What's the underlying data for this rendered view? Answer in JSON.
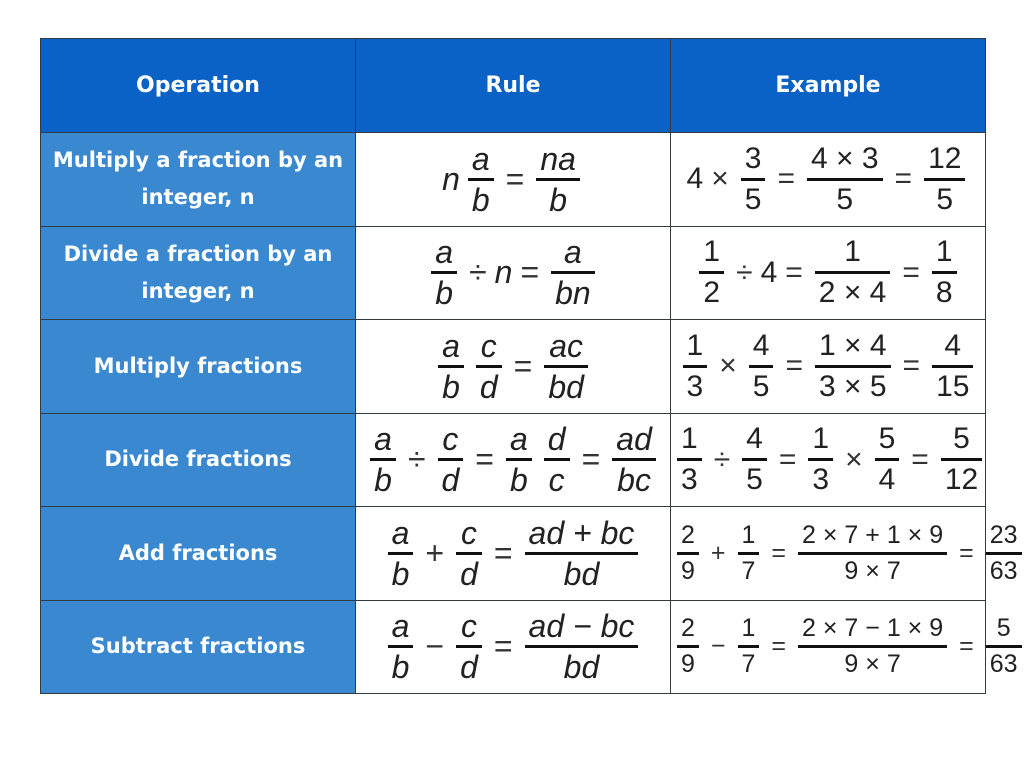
{
  "header": {
    "operation": "Operation",
    "rule": "Rule",
    "example": "Example"
  },
  "rows": [
    {
      "operation": "Multiply a fraction by an integer, n",
      "rule": [
        {
          "t": "term",
          "v": "n"
        },
        {
          "t": "frac",
          "n": "a",
          "d": "b"
        },
        {
          "t": "op",
          "v": "="
        },
        {
          "t": "frac",
          "n": "na",
          "d": "b"
        }
      ],
      "example": [
        {
          "t": "term",
          "v": "4"
        },
        {
          "t": "op",
          "v": "×"
        },
        {
          "t": "frac",
          "n": "3",
          "d": "5"
        },
        {
          "t": "op",
          "v": "="
        },
        {
          "t": "frac",
          "n": "4 × 3",
          "d": "5"
        },
        {
          "t": "op",
          "v": "="
        },
        {
          "t": "frac",
          "n": "12",
          "d": "5"
        }
      ]
    },
    {
      "operation": "Divide a fraction by an integer, n",
      "rule": [
        {
          "t": "frac",
          "n": "a",
          "d": "b"
        },
        {
          "t": "op",
          "v": "÷"
        },
        {
          "t": "term",
          "v": "n"
        },
        {
          "t": "op",
          "v": "="
        },
        {
          "t": "frac",
          "n": "a",
          "d": "bn"
        }
      ],
      "example": [
        {
          "t": "frac",
          "n": "1",
          "d": "2"
        },
        {
          "t": "op",
          "v": "÷"
        },
        {
          "t": "term",
          "v": "4"
        },
        {
          "t": "op",
          "v": "="
        },
        {
          "t": "frac",
          "n": "1",
          "d": "2 × 4"
        },
        {
          "t": "op",
          "v": "="
        },
        {
          "t": "frac",
          "n": "1",
          "d": "8"
        }
      ]
    },
    {
      "operation": "Multiply fractions",
      "rule": [
        {
          "t": "frac",
          "n": "a",
          "d": "b"
        },
        {
          "t": "frac",
          "n": "c",
          "d": "d"
        },
        {
          "t": "op",
          "v": "="
        },
        {
          "t": "frac",
          "n": "ac",
          "d": "bd"
        }
      ],
      "example": [
        {
          "t": "frac",
          "n": "1",
          "d": "3"
        },
        {
          "t": "op",
          "v": "×"
        },
        {
          "t": "frac",
          "n": "4",
          "d": "5"
        },
        {
          "t": "op",
          "v": "="
        },
        {
          "t": "frac",
          "n": "1 × 4",
          "d": "3 × 5"
        },
        {
          "t": "op",
          "v": "="
        },
        {
          "t": "frac",
          "n": "4",
          "d": "15"
        }
      ]
    },
    {
      "operation": "Divide fractions",
      "rule": [
        {
          "t": "frac",
          "n": "a",
          "d": "b"
        },
        {
          "t": "op",
          "v": "÷"
        },
        {
          "t": "frac",
          "n": "c",
          "d": "d"
        },
        {
          "t": "op",
          "v": "="
        },
        {
          "t": "frac",
          "n": "a",
          "d": "b"
        },
        {
          "t": "frac",
          "n": "d",
          "d": "c"
        },
        {
          "t": "op",
          "v": "="
        },
        {
          "t": "frac",
          "n": "ad",
          "d": "bc"
        }
      ],
      "example": [
        {
          "t": "frac",
          "n": "1",
          "d": "3"
        },
        {
          "t": "op",
          "v": "÷"
        },
        {
          "t": "frac",
          "n": "4",
          "d": "5"
        },
        {
          "t": "op",
          "v": "="
        },
        {
          "t": "frac",
          "n": "1",
          "d": "3"
        },
        {
          "t": "op",
          "v": "×"
        },
        {
          "t": "frac",
          "n": "5",
          "d": "4"
        },
        {
          "t": "op",
          "v": "="
        },
        {
          "t": "frac",
          "n": "5",
          "d": "12"
        }
      ]
    },
    {
      "operation": "Add fractions",
      "rule": [
        {
          "t": "frac",
          "n": "a",
          "d": "b"
        },
        {
          "t": "op",
          "v": "+"
        },
        {
          "t": "frac",
          "n": "c",
          "d": "d"
        },
        {
          "t": "op",
          "v": "="
        },
        {
          "t": "frac",
          "n": "ad + bc",
          "d": "bd"
        }
      ],
      "example": [
        {
          "t": "frac",
          "n": "2",
          "d": "9"
        },
        {
          "t": "op",
          "v": "+"
        },
        {
          "t": "frac",
          "n": "1",
          "d": "7"
        },
        {
          "t": "op",
          "v": "="
        },
        {
          "t": "frac",
          "n": "2 × 7 + 1 × 9",
          "d": "9 × 7"
        },
        {
          "t": "op",
          "v": "="
        },
        {
          "t": "frac",
          "n": "23",
          "d": "63"
        }
      ]
    },
    {
      "operation": "Subtract fractions",
      "rule": [
        {
          "t": "frac",
          "n": "a",
          "d": "b"
        },
        {
          "t": "op",
          "v": "−"
        },
        {
          "t": "frac",
          "n": "c",
          "d": "d"
        },
        {
          "t": "op",
          "v": "="
        },
        {
          "t": "frac",
          "n": "ad − bc",
          "d": "bd"
        }
      ],
      "example": [
        {
          "t": "frac",
          "n": "2",
          "d": "9"
        },
        {
          "t": "op",
          "v": "−"
        },
        {
          "t": "frac",
          "n": "1",
          "d": "7"
        },
        {
          "t": "op",
          "v": "="
        },
        {
          "t": "frac",
          "n": "2 × 7 − 1 × 9",
          "d": "9 × 7"
        },
        {
          "t": "op",
          "v": "="
        },
        {
          "t": "frac",
          "n": "5",
          "d": "63"
        }
      ]
    }
  ],
  "colors": {
    "header_bg": "#0b62c6",
    "operation_bg": "#3a88d0",
    "text_on_blue": "#ffffff"
  }
}
